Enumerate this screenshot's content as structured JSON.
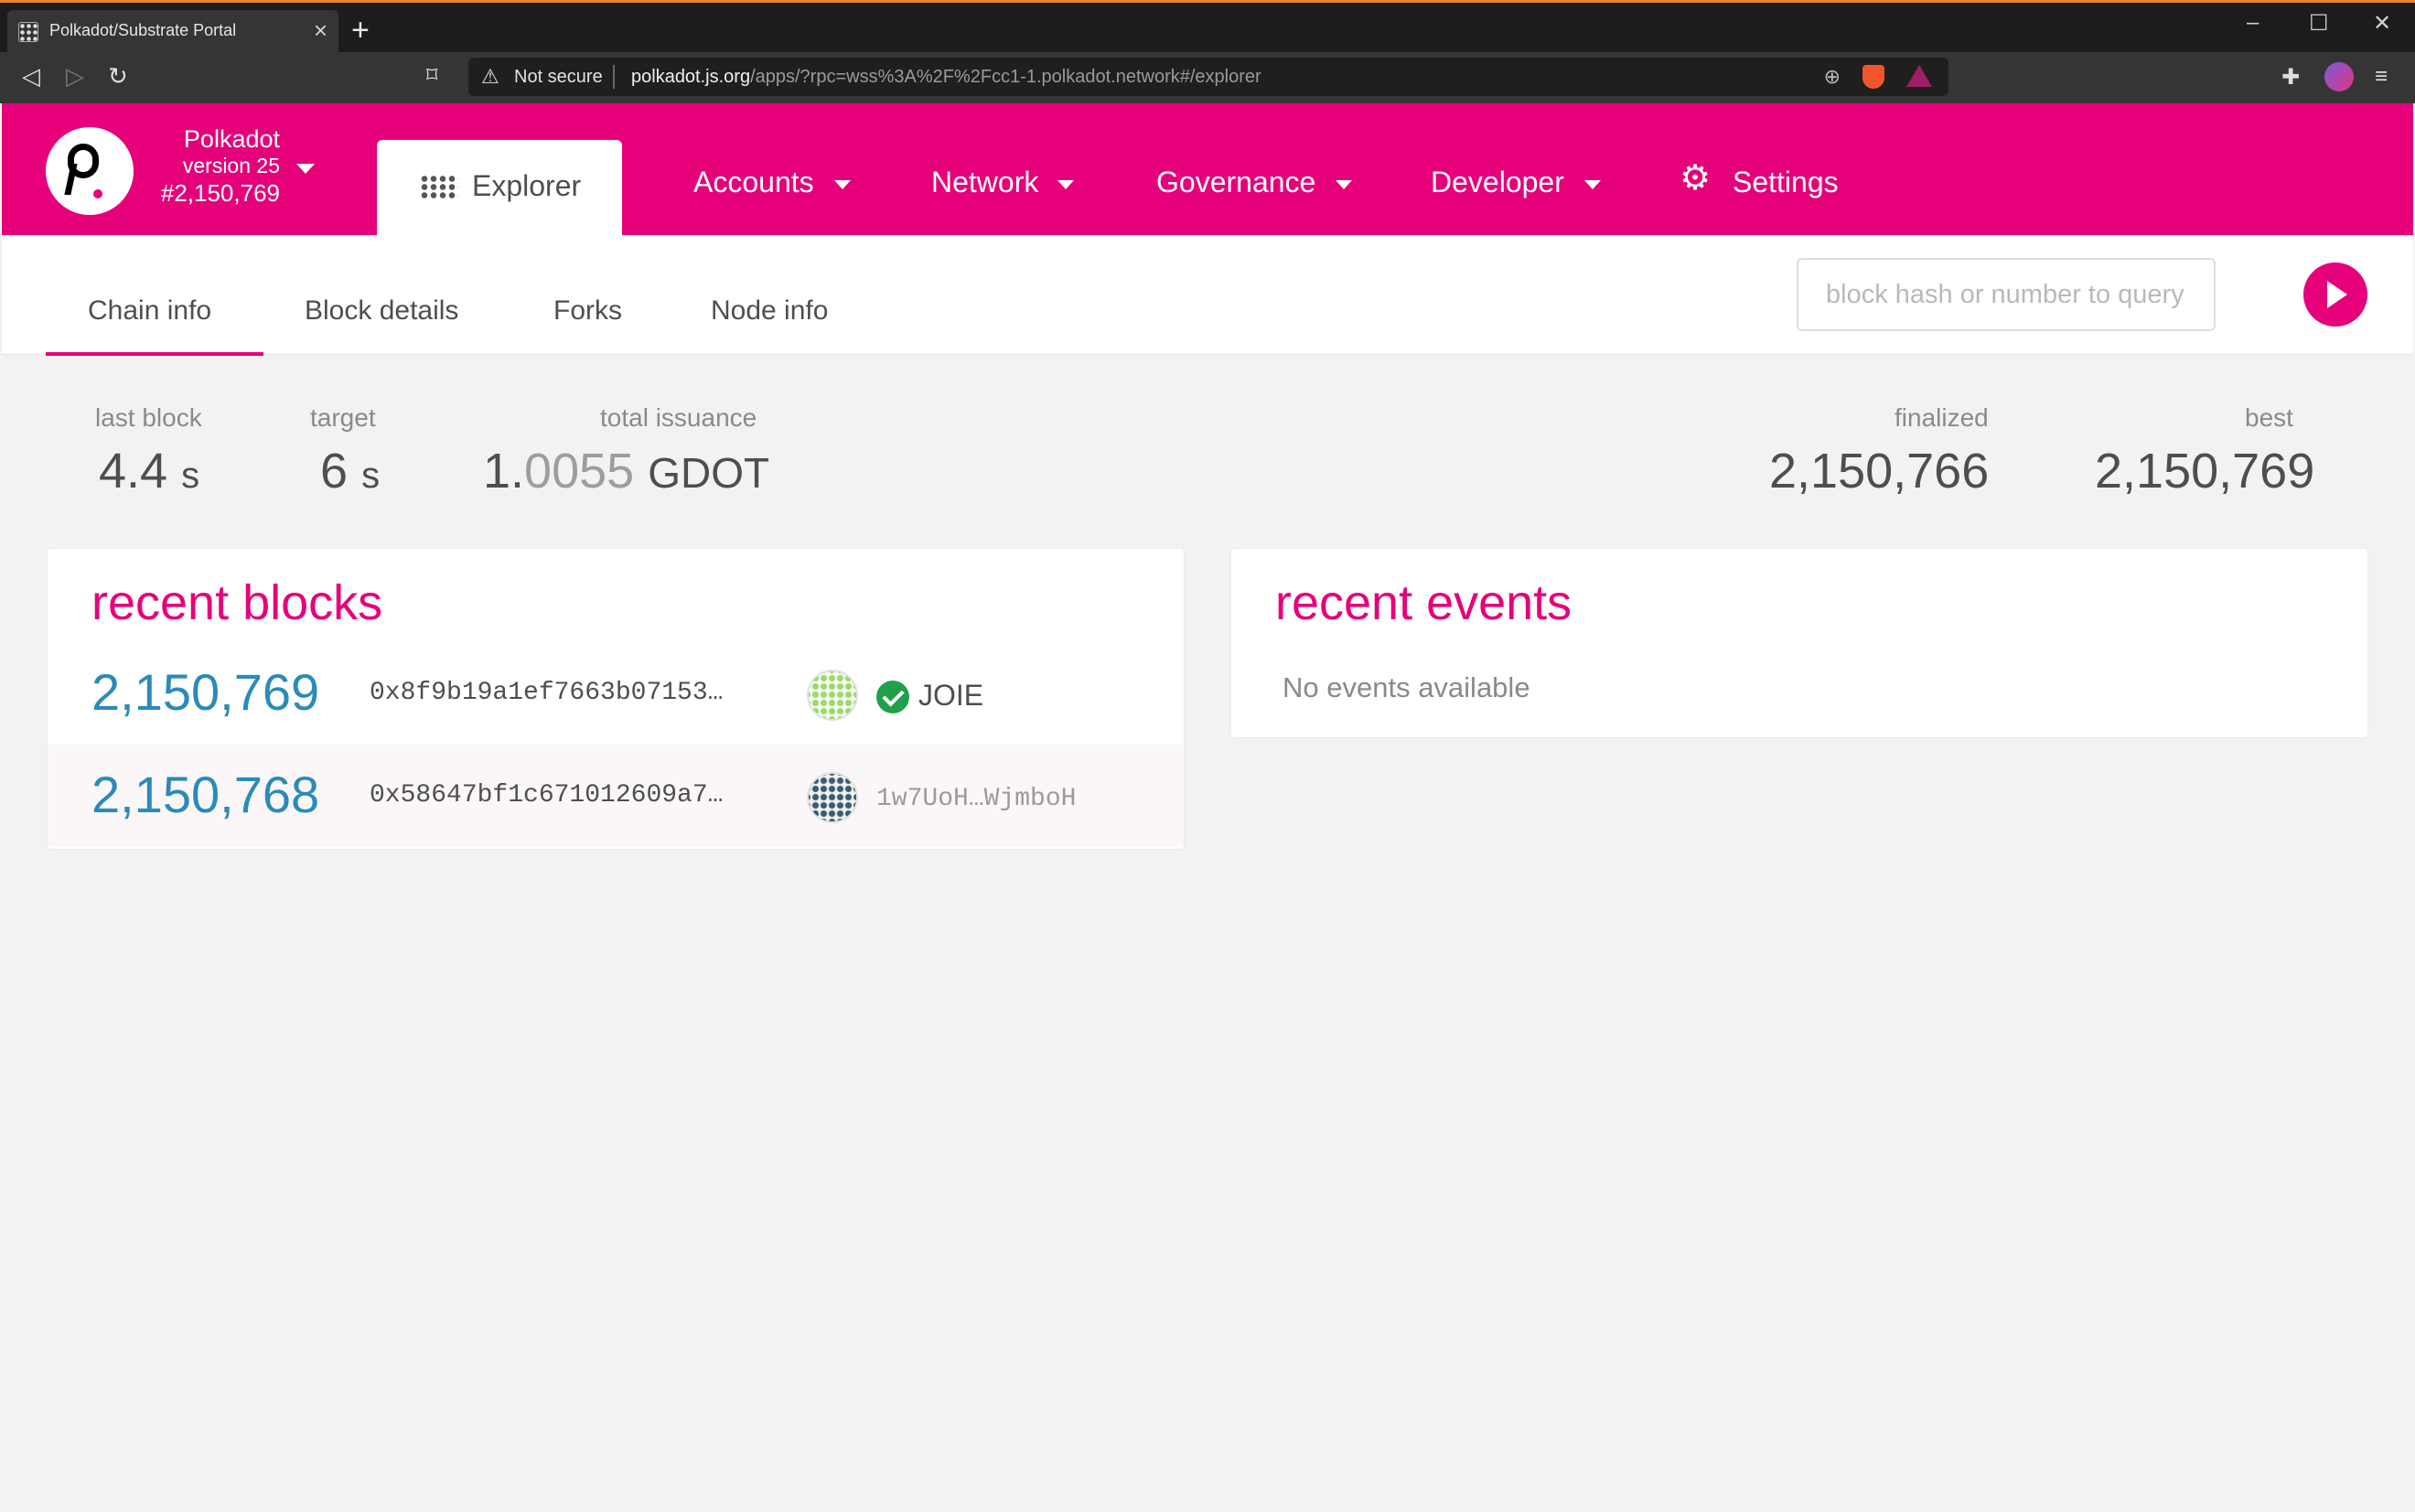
{
  "browser": {
    "tab_title": "Polkadot/Substrate Portal",
    "tab_close": "×",
    "new_tab": "+",
    "security_label": "Not secure",
    "url_host": "polkadot.js.org",
    "url_path": "/apps/?rpc=wss%3A%2F%2Fcc1-1.polkadot.network#/explorer",
    "minimize": "–",
    "maximize": "☐",
    "close": "✕"
  },
  "chain": {
    "name": "Polkadot",
    "version": "version 25",
    "block": "#2,150,769"
  },
  "menu": {
    "explorer": "Explorer",
    "accounts": "Accounts",
    "network": "Network",
    "governance": "Governance",
    "developer": "Developer",
    "settings": "Settings"
  },
  "subnav": {
    "tabs": [
      "Chain info",
      "Block details",
      "Forks",
      "Node info"
    ],
    "query_placeholder": "block hash or number to query"
  },
  "summary": {
    "last_block_label": "last block",
    "last_block_value": "4.4",
    "last_block_unit": "s",
    "target_label": "target",
    "target_value": "6",
    "target_unit": "s",
    "issuance_label": "total issuance",
    "issuance_int": "1.",
    "issuance_frac": "0055",
    "issuance_unit": "GDOT",
    "finalized_label": "finalized",
    "finalized_value": "2,150,766",
    "best_label": "best",
    "best_value": "2,150,769"
  },
  "recent_blocks": {
    "title": "recent blocks",
    "rows": [
      {
        "number": "2,150,769",
        "hash": "0x8f9b19a1ef7663b07153…",
        "author": "JOIE"
      },
      {
        "number": "2,150,768",
        "hash": "0x58647bf1c671012609a7…",
        "author": "1w7UoH…WjmboH"
      }
    ]
  },
  "recent_events": {
    "title": "recent events",
    "empty": "No events available"
  },
  "colors": {
    "accent": "#e6007a",
    "block_number": "#2a8bb8",
    "verified": "#21a04a"
  }
}
